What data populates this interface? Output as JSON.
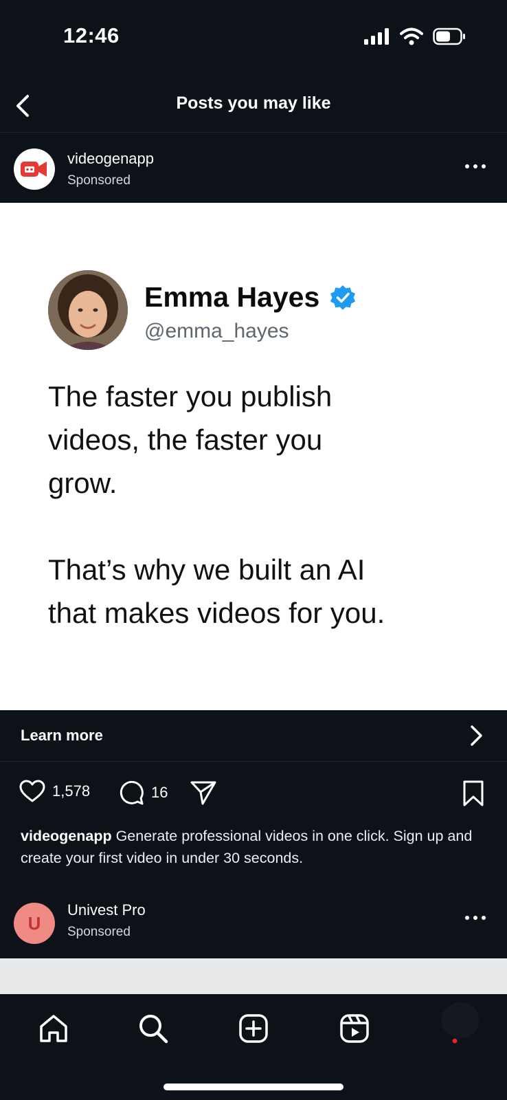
{
  "status_bar": {
    "time": "12:46"
  },
  "header": {
    "title": "Posts you may like"
  },
  "post": {
    "account": "videogenapp",
    "sponsored": "Sponsored",
    "image": {
      "name": "Emma Hayes",
      "handle": "@emma_hayes",
      "text": "The faster you publish\nvideos, the faster you\ngrow.\n\nThat’s why we built an AI\nthat makes videos for you."
    },
    "cta": "Learn more",
    "likes": "1,578",
    "comments": "16",
    "caption_account": "videogenapp",
    "caption_text": " Generate professional videos in one click. Sign up and create your first video in under 30 seconds."
  },
  "next_post": {
    "initial": "U",
    "account": "Univest Pro",
    "sponsored": "Sponsored"
  },
  "colors": {
    "background": "#0d1118",
    "verified": "#1d9bf0",
    "brand_red": "#e53935",
    "univest_avatar": "#f08a84"
  }
}
